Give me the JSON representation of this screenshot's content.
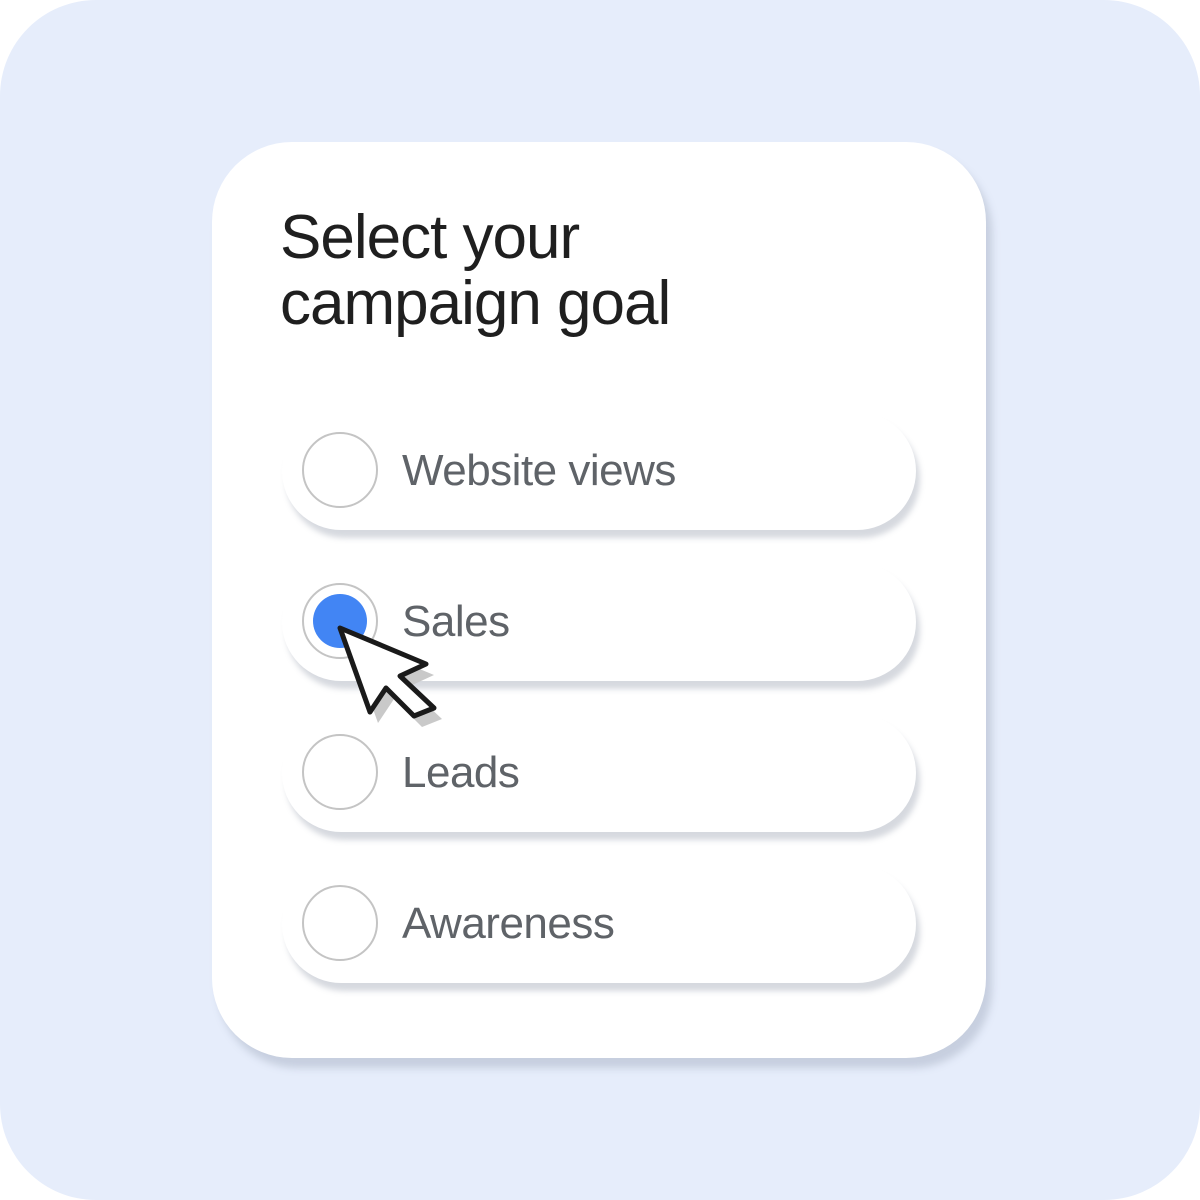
{
  "heading": "Select your\ncampaign goal",
  "options": [
    {
      "label": "Website views",
      "selected": false
    },
    {
      "label": "Sales",
      "selected": true
    },
    {
      "label": "Leads",
      "selected": false
    },
    {
      "label": "Awareness",
      "selected": false
    }
  ],
  "colors": {
    "background": "#e6edfb",
    "card": "#ffffff",
    "accent": "#4285f4",
    "heading_text": "#1f1f1f",
    "option_text": "#5f6368"
  },
  "icons": {
    "pointer": "cursor-arrow-icon"
  }
}
